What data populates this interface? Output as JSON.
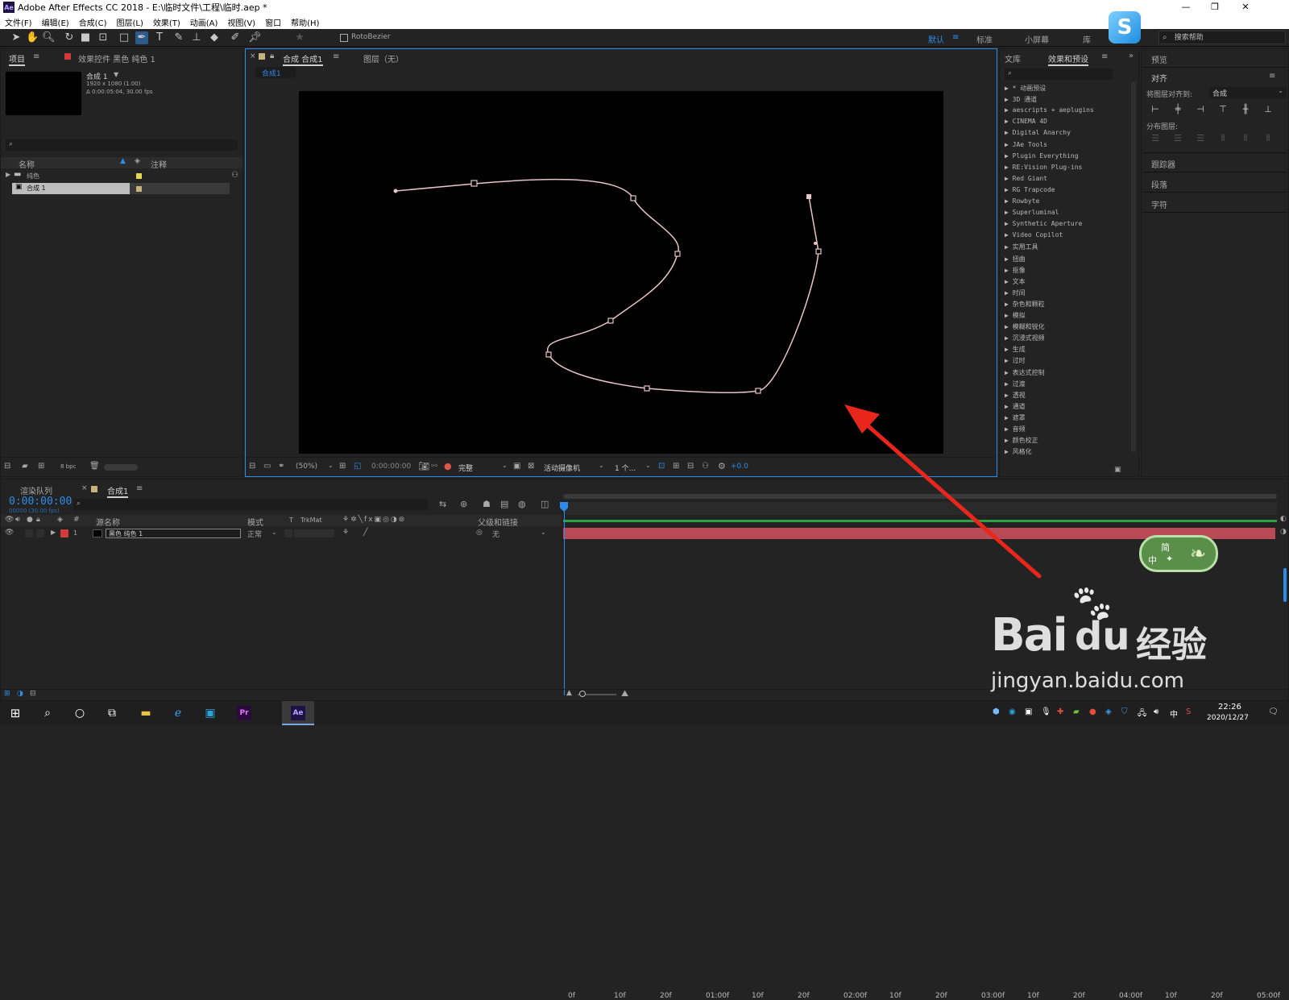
{
  "window": {
    "title": "Adobe After Effects CC 2018 - E:\\临时文件\\工程\\临时.aep *",
    "logo": "Ae",
    "min": "—",
    "restore": "❐",
    "close": "✕"
  },
  "menu": [
    "文件(F)",
    "编辑(E)",
    "合成(C)",
    "图层(L)",
    "效果(T)",
    "动画(A)",
    "视图(V)",
    "窗口",
    "帮助(H)"
  ],
  "toolbar": {
    "rotobezier": "RotoBezier",
    "workspaces": [
      "默认",
      "标准",
      "小屏幕",
      "库"
    ],
    "search_placeholder": "搜索帮助"
  },
  "project": {
    "tab": "项目",
    "effect_controls": "效果控件 黑色 纯色 1",
    "comp_name": "合成 1",
    "comp_info1": "1920 x 1080 (1.00)",
    "comp_info2": "Δ 0:00:05:04, 30.00 fps",
    "col_name": "名称",
    "col_comment": "注释",
    "items": [
      "纯色",
      "合成 1"
    ],
    "bpc": "8 bpc"
  },
  "viewer": {
    "tab": "合成 合成1",
    "layer_tab": "图层（无）",
    "breadcrumb": "合成1",
    "zoom": "(50%)",
    "time": "0:00:00:00",
    "quality": "完整",
    "camera": "活动摄像机",
    "views": "1 个...",
    "exposure": "+0.0"
  },
  "effects": {
    "tab_lib": "文库",
    "tab": "效果和预设",
    "items": [
      "* 动画预设",
      "3D 通道",
      "aescripts + aeplugins",
      "CINEMA 4D",
      "Digital Anarchy",
      "JAe Tools",
      "Plugin Everything",
      "RE:Vision Plug-ins",
      "Red Giant",
      "RG Trapcode",
      "Rowbyte",
      "Superluminal",
      "Synthetic Aperture",
      "Video Copilot",
      "实用工具",
      "扭曲",
      "抠像",
      "文本",
      "时间",
      "杂色和颗粒",
      "模拟",
      "模糊和锐化",
      "沉浸式视频",
      "生成",
      "过时",
      "表达式控制",
      "过渡",
      "透视",
      "通道",
      "遮罩",
      "音频",
      "颜色校正",
      "风格化"
    ]
  },
  "right_panel": {
    "preview": "预览",
    "align": "对齐",
    "align_to_label": "将图层对齐到:",
    "align_to_value": "合成",
    "distribute": "分布图层:",
    "tracker": "跟踪器",
    "paragraph": "段落",
    "character": "字符"
  },
  "timeline": {
    "render_queue": "渲染队列",
    "comp_tab": "合成1",
    "timecode": "0:00:00:00",
    "timecode_sub": "00000 (30.00 fps)",
    "col_source": "源名称",
    "col_mode": "模式",
    "col_t": "T",
    "col_trkmat": "TrkMat",
    "col_parent": "父级和链接",
    "layer_num": "1",
    "layer_name": "黑色 纯色 1",
    "layer_mode": "正常",
    "layer_parent": "无",
    "ruler": [
      "0f",
      "10f",
      "20f",
      "01:00f",
      "10f",
      "20f",
      "02:00f",
      "10f",
      "20f",
      "03:00f",
      "10f",
      "20f",
      "04:00f",
      "10f",
      "20f",
      "05:00f"
    ]
  },
  "ime": {
    "top": "简",
    "bottom": "中"
  },
  "watermark": {
    "brand": "Bai",
    "brand2": "du",
    "cn": "经验",
    "url": "jingyan.baidu.com"
  },
  "taskbar": {
    "clock": "22:26",
    "date": "2020/12/27",
    "ime": "中",
    "apps": [
      "start-icon",
      "search-icon",
      "cortana-icon",
      "taskview-icon",
      "explorer-icon",
      "edge-icon",
      "app-icon",
      "premiere-icon",
      "aftereffects-icon"
    ]
  },
  "colors": {
    "accent": "#2d8ceb",
    "layer_bar": "#b94a55",
    "path": "#e8c3c8",
    "arrow": "#e8261c"
  }
}
